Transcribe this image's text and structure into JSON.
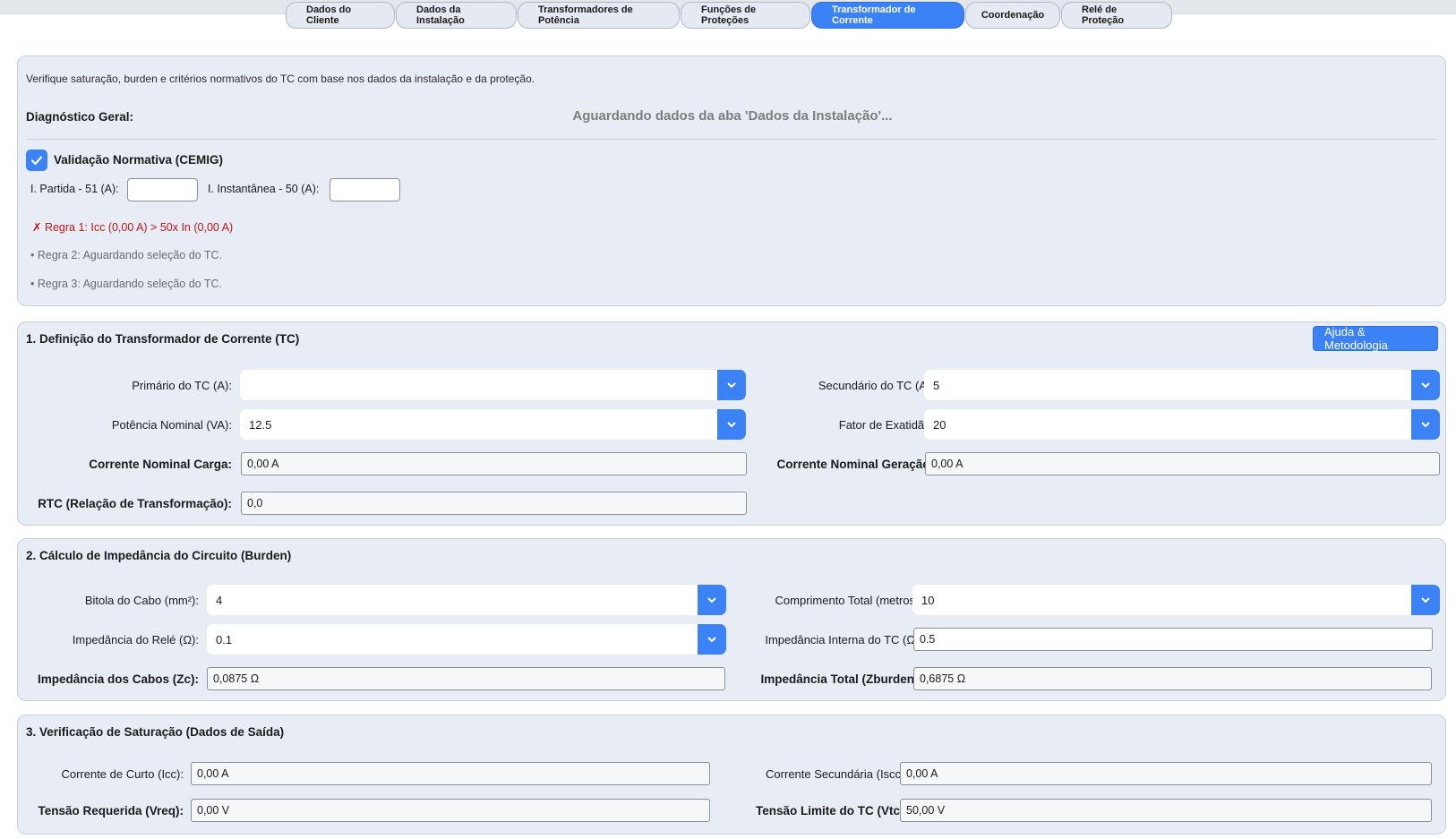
{
  "tabs": [
    {
      "label": "Dados do Cliente"
    },
    {
      "label": "Dados da Instalação"
    },
    {
      "label": "Transformadores de Potência"
    },
    {
      "label": "Funções de Proteções"
    },
    {
      "label": "Transformador de Corrente"
    },
    {
      "label": "Coordenação"
    },
    {
      "label": "Relé de Proteção"
    }
  ],
  "active_tab": "Transformador de Corrente",
  "summary": {
    "intro": "Verifique saturação, burden e critérios normativos do TC com base nos dados da instalação e da proteção.",
    "diagnostic_label": "Diagnóstico Geral:",
    "diagnostic_status": "Aguardando dados da aba 'Dados da Instalação'...",
    "validation_label": "Validação Normativa (CEMIG)",
    "validation_checked": true,
    "pickup_51_label": "I. Partida - 51 (A):",
    "pickup_51_value": "",
    "inst_50_label": "I. Instantânea - 50 (A):",
    "inst_50_value": "",
    "rule1": "✗  Regra 1: Icc (0,00 A) > 50x In (0,00 A)",
    "rule2": "• Regra 2: Aguardando seleção do TC.",
    "rule3": "• Regra 3: Aguardando seleção do TC."
  },
  "section1": {
    "title": "1. Definição do Transformador de Corrente (TC)",
    "help_button": "Ajuda & Metodologia",
    "primary_label": "Primário do TC (A):",
    "primary_value": "",
    "secondary_label": "Secundário do TC (A):",
    "secondary_value": "5",
    "power_label": "Potência Nominal (VA):",
    "power_value": "12.5",
    "accuracy_label": "Fator de Exatidão:",
    "accuracy_value": "20",
    "load_current_label": "Corrente Nominal Carga:",
    "load_current_value": "0,00 A",
    "gen_current_label": "Corrente Nominal Geração:",
    "gen_current_value": "0,00 A",
    "rtc_label": "RTC (Relação de Transformação):",
    "rtc_value": "0,0"
  },
  "section2": {
    "title": "2. Cálculo de Impedância do Circuito (Burden)",
    "cable_label": "Bitola do Cabo (mm²):",
    "cable_value": "4",
    "length_label": "Comprimento Total (metros):",
    "length_value": "10",
    "relay_imp_label": "Impedância do Relé (Ω):",
    "relay_imp_value": "0.1",
    "internal_imp_label": "Impedância Interna do TC (Ω):",
    "internal_imp_value": "0.5",
    "cable_imp_label": "Impedância dos Cabos (Zc):",
    "cable_imp_value": "0,0875 Ω",
    "total_imp_label": "Impedância Total (Zburden):",
    "total_imp_value": "0,6875 Ω"
  },
  "section3": {
    "title": "3. Verificação de Saturação (Dados de Saída)",
    "icc_label": "Corrente de Curto (Icc):",
    "icc_value": "0,00 A",
    "iscc_label": "Corrente Secundária (Iscc):",
    "iscc_value": "0,00 A",
    "vreq_label": "Tensão Requerida (Vreq):",
    "vreq_value": "0,00 V",
    "vtc_label": "Tensão Limite do TC (Vtc):",
    "vtc_value": "50,00 V"
  },
  "colors": {
    "accent": "#3b82f6",
    "panel_bg": "#e8edf5",
    "error": "#c0141a"
  }
}
